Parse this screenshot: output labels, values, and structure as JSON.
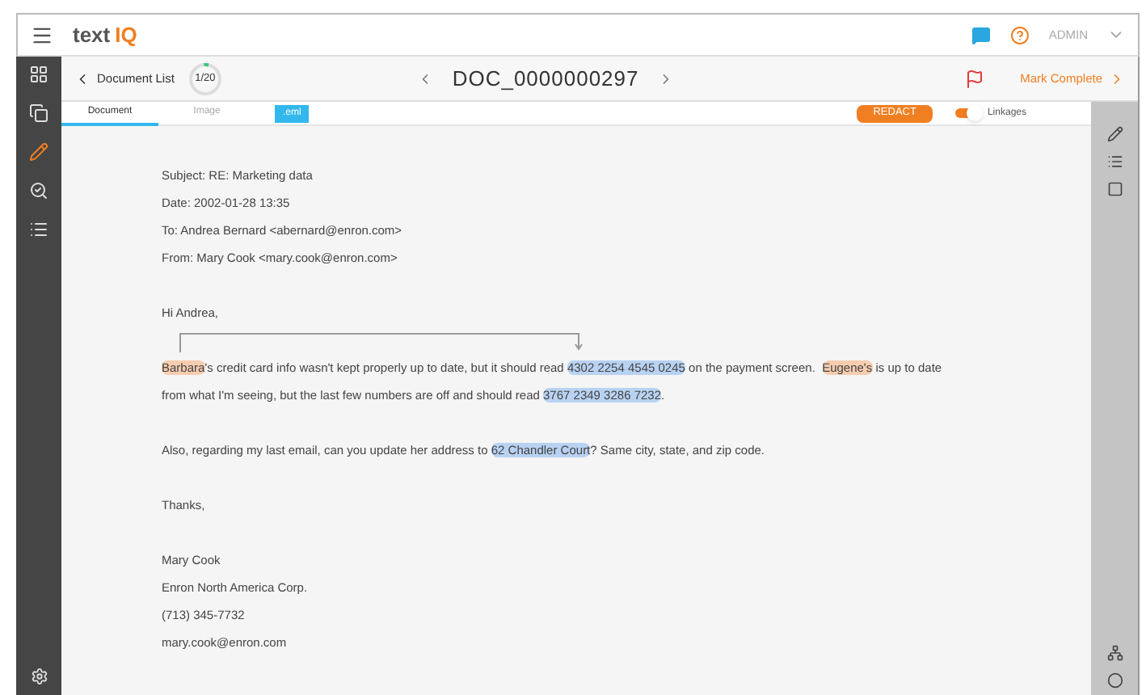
{
  "app": {
    "logo_text": "text ",
    "logo_accent": "IQ",
    "user": "ADMIN"
  },
  "sidebar": {
    "items": [
      {
        "kind": "dashboard",
        "selected": false
      },
      {
        "kind": "documents",
        "selected": false
      },
      {
        "kind": "edit",
        "selected": true
      },
      {
        "kind": "search",
        "selected": false
      },
      {
        "kind": "list",
        "selected": false
      }
    ]
  },
  "doc_header": {
    "back_label": "Document List",
    "counter": "1/20",
    "level": 0.05,
    "title": "DOC_0000000297",
    "mark_complete": "Mark Complete"
  },
  "tabs": [
    {
      "label": "Document",
      "selected": true,
      "kind": "tab"
    },
    {
      "label": "Image",
      "selected": false,
      "kind": "tab"
    },
    {
      "label": ".eml",
      "selected": false,
      "kind": "badge"
    }
  ],
  "redact_button": "REDACT",
  "linkages": {
    "label": "Linkages",
    "on": true
  },
  "blocks": [
    [
      [
        {
          "text": "Subject: RE: Marketing data",
          "kind": "plain"
        }
      ],
      [
        {
          "text": "Date: 2002-01-28 13:35",
          "kind": "plain"
        }
      ],
      [
        {
          "text": "To: Andrea Bernard <abernard@enron.com>",
          "kind": "plain"
        }
      ],
      [
        {
          "text": "From: Mary Cook <mary.cook@enron.com>",
          "kind": "plain"
        }
      ]
    ],
    [
      [
        {
          "text": "Hi Andrea,",
          "kind": "plain"
        }
      ]
    ],
    [
      [
        {
          "text": "Barbara",
          "kind": "person"
        },
        {
          "text": "'s credit card info wasn't kept properly up to date, but it should read ",
          "kind": "plain"
        },
        {
          "text": "4302 2254 4545 0245",
          "kind": "number"
        },
        {
          "text": " on the payment screen.  ",
          "kind": "plain"
        },
        {
          "text": "Eugene's",
          "kind": "person"
        },
        {
          "text": " is up to date",
          "kind": "plain"
        }
      ],
      [
        {
          "text": "from what I'm seeing, but the last few numbers are off and should read ",
          "kind": "plain"
        },
        {
          "text": "3767 2349 3286 7232",
          "kind": "number"
        },
        {
          "text": ".",
          "kind": "plain"
        }
      ]
    ],
    [
      [
        {
          "text": "Also, regarding my last email, can you update her address to ",
          "kind": "plain"
        },
        {
          "text": "62 Chandler Court",
          "kind": "number"
        },
        {
          "text": "? Same city, state, and zip code.",
          "kind": "plain"
        }
      ]
    ],
    [
      [
        {
          "text": "Thanks,",
          "kind": "plain"
        }
      ]
    ],
    [
      [
        {
          "text": "Mary Cook",
          "kind": "plain"
        }
      ],
      [
        {
          "text": "Enron North America Corp.",
          "kind": "plain"
        }
      ],
      [
        {
          "text": "(713) 345-7732",
          "kind": "plain"
        }
      ],
      [
        {
          "text": "mary.cook@enron.com",
          "kind": "plain"
        }
      ]
    ]
  ]
}
